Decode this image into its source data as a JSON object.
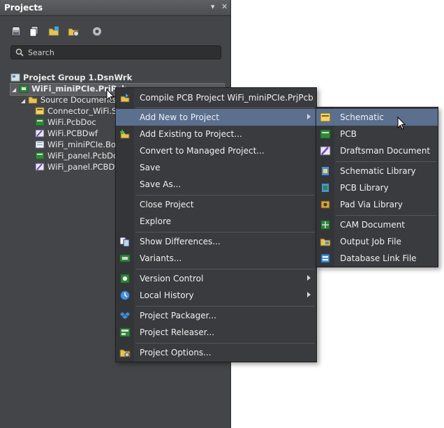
{
  "panel": {
    "title": "Projects",
    "pin_glyph": "▾",
    "close_glyph": "✕",
    "search_placeholder": "Search"
  },
  "tree": {
    "group": "Project Group 1.DsnWrk",
    "project": "WiFi_miniPCIe.PrjPcb",
    "source_folder": "Source Documents",
    "files": [
      "Connector_WiFi.Sc",
      "WiFi.PcbDoc",
      "WiFi.PCBDwf",
      "WiFi_miniPCIe.Bom",
      "WiFi_panel.PcbDoc",
      "WiFi_panel.PCBDw"
    ]
  },
  "context_menu": {
    "items": [
      {
        "label": "Compile PCB Project WiFi_miniPCIe.PrjPcb",
        "icon": "compile-icon"
      },
      {
        "label": "Add New to Project",
        "icon": "",
        "submenu": true,
        "highlighted": true
      },
      {
        "label": "Add Existing to Project...",
        "icon": "add-existing-icon"
      },
      {
        "label": "Convert to Managed Project...",
        "icon": ""
      },
      {
        "label": "Save",
        "icon": ""
      },
      {
        "label": "Save As...",
        "icon": ""
      },
      {
        "label": "Close Project",
        "icon": ""
      },
      {
        "label": "Explore",
        "icon": ""
      },
      {
        "label": "Show Differences...",
        "icon": "differences-icon"
      },
      {
        "label": "Variants...",
        "icon": "variants-icon"
      },
      {
        "label": "Version Control",
        "icon": "version-control-icon",
        "submenu": true
      },
      {
        "label": "Local History",
        "icon": "history-icon",
        "submenu": true
      },
      {
        "label": "Project Packager...",
        "icon": "packager-icon"
      },
      {
        "label": "Project Releaser...",
        "icon": "releaser-icon"
      },
      {
        "label": "Project Options...",
        "icon": "options-icon"
      }
    ]
  },
  "submenu": {
    "items": [
      {
        "label": "Schematic",
        "icon": "schematic-icon",
        "highlighted": true
      },
      {
        "label": "PCB",
        "icon": "pcb-icon"
      },
      {
        "label": "Draftsman Document",
        "icon": "draftsman-icon"
      },
      {
        "label": "Schematic Library",
        "icon": "schlib-icon"
      },
      {
        "label": "PCB Library",
        "icon": "pcblib-icon"
      },
      {
        "label": "Pad Via Library",
        "icon": "padvia-icon"
      },
      {
        "label": "CAM Document",
        "icon": "cam-icon"
      },
      {
        "label": "Output Job File",
        "icon": "outjob-icon"
      },
      {
        "label": "Database Link File",
        "icon": "dblink-icon"
      }
    ]
  },
  "colors": {
    "panel_bg": "#434548",
    "menu_bg": "#3a3b3e",
    "highlight": "#5b6f8f",
    "text": "#f0f0f0"
  }
}
